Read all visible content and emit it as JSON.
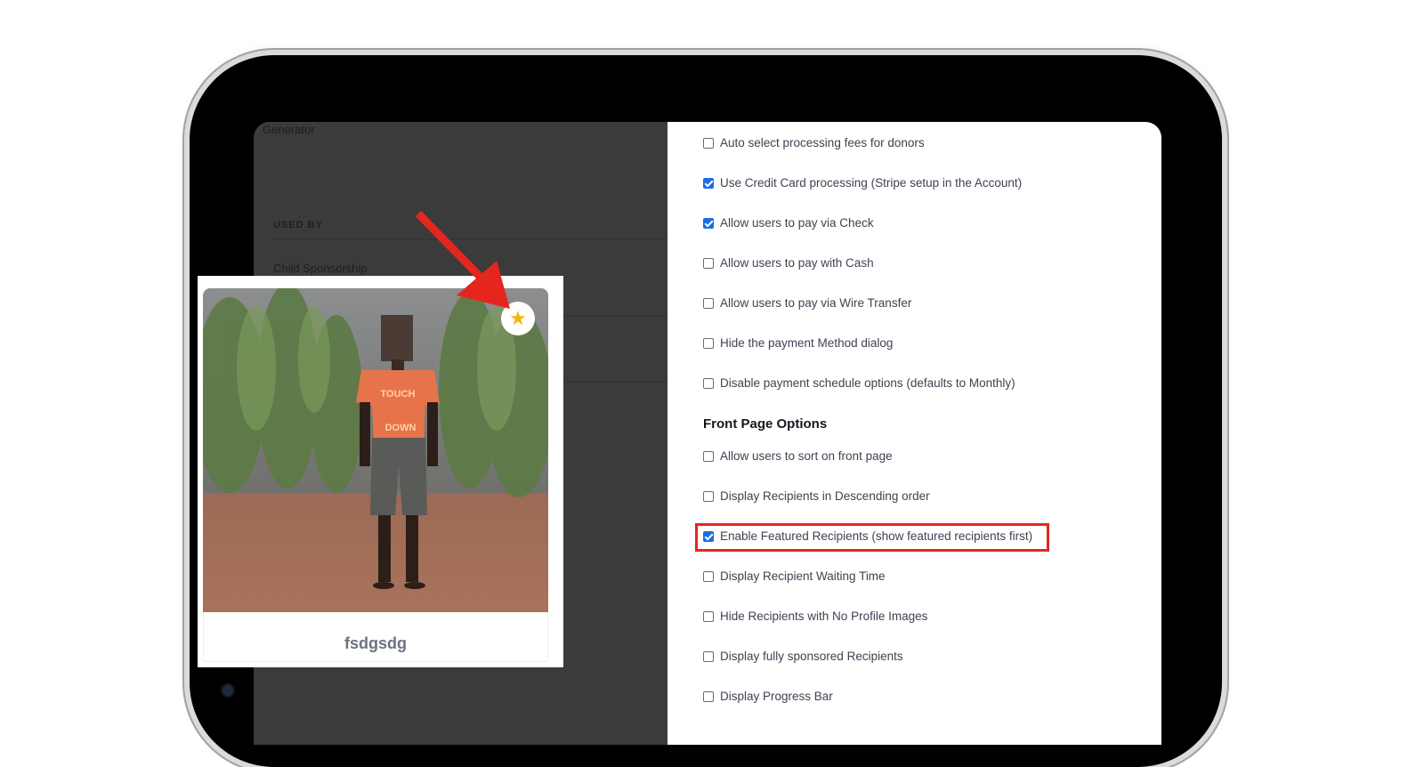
{
  "left_panel": {
    "generator_text": "Generator",
    "used_by_label": "USED BY",
    "used_by_item": "Child Sponsorship Search"
  },
  "settings": {
    "payment_options": [
      {
        "label": "Auto select processing fees for donors",
        "checked": false
      },
      {
        "label": "Use Credit Card processing (Stripe setup in the Account)",
        "checked": true
      },
      {
        "label": "Allow users to pay via Check",
        "checked": true
      },
      {
        "label": "Allow users to pay with Cash",
        "checked": false
      },
      {
        "label": "Allow users to pay via Wire Transfer",
        "checked": false
      },
      {
        "label": "Hide the payment Method dialog",
        "checked": false
      },
      {
        "label": "Disable payment schedule options (defaults to Monthly)",
        "checked": false
      }
    ],
    "front_page_title": "Front Page Options",
    "front_page_options": [
      {
        "label": "Allow users to sort on front page",
        "checked": false
      },
      {
        "label": "Display Recipients in Descending order",
        "checked": false
      },
      {
        "label": "Enable Featured Recipients (show featured recipients first)",
        "checked": true,
        "highlighted": true
      },
      {
        "label": "Display Recipient Waiting Time",
        "checked": false
      },
      {
        "label": "Hide Recipients with No Profile Images",
        "checked": false
      },
      {
        "label": "Display fully sponsored Recipients",
        "checked": false
      },
      {
        "label": "Display Progress Bar",
        "checked": false
      }
    ]
  },
  "recipient_card": {
    "name": "fsdgsdg",
    "featured_icon": "star-icon",
    "star_color": "#f3b60b",
    "shirt_text": "TOUCH DOWN"
  },
  "colors": {
    "highlight": "#e5261e",
    "arrow": "#e5261e",
    "checkbox_checked": "#1a6fe0"
  }
}
